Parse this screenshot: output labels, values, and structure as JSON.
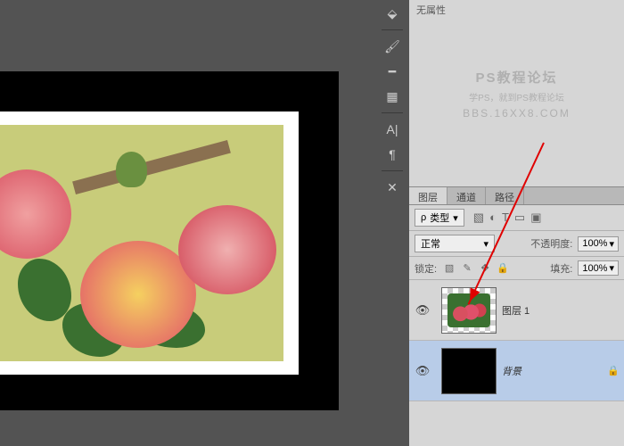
{
  "properties": {
    "header": "无属性"
  },
  "watermark": {
    "line1": "PS教程论坛",
    "line2": "学PS，就到PS教程论坛",
    "line3": "BBS.16XX8.COM"
  },
  "tabs": [
    {
      "label": "图层",
      "active": true
    },
    {
      "label": "通道",
      "active": false
    },
    {
      "label": "路径",
      "active": false
    }
  ],
  "filter": {
    "kind": "类型"
  },
  "blend": {
    "mode": "正常",
    "opacity_label": "不透明度:",
    "opacity": "100%"
  },
  "lock": {
    "label": "锁定:",
    "fill_label": "填充:",
    "fill": "100%"
  },
  "layers": [
    {
      "name": "图层 1",
      "visible": true,
      "locked": false,
      "thumb": "flowers",
      "selected": false
    },
    {
      "name": "背景",
      "visible": true,
      "locked": true,
      "thumb": "black",
      "selected": true
    }
  ],
  "icons": {
    "magnet": "⬙",
    "brush": "🖌",
    "stroke": "━",
    "swatch": "▦",
    "typeA": "A|",
    "para": "¶",
    "wrench": "✕"
  }
}
